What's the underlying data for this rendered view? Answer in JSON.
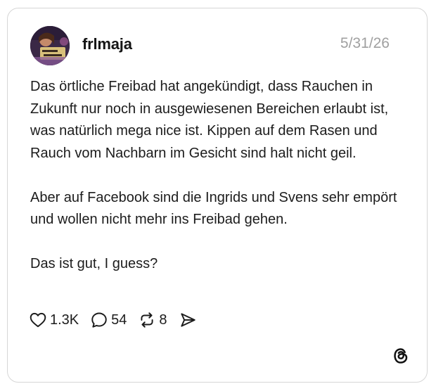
{
  "post": {
    "username": "frlmaja",
    "date": "5/31/26",
    "avatar_alt": "profile photo",
    "paragraphs": [
      "Das örtliche Freibad hat angekündigt, dass Rauchen in Zukunft nur noch in ausgewiesenen Bereichen erlaubt ist, was natürlich mega nice ist. Kippen auf dem Rasen und Rauch vom Nachbarn im Gesicht sind halt nicht geil.",
      "Aber auf Facebook sind die Ingrids und Svens sehr empört und wollen nicht mehr ins Freibad gehen.",
      "Das ist gut, I guess?"
    ]
  },
  "actions": {
    "likes": "1.3K",
    "replies": "54",
    "reposts": "8"
  },
  "icons": {
    "like": "heart-icon",
    "reply": "speech-bubble-icon",
    "repost": "repost-arrows-icon",
    "share": "send-icon",
    "brand": "threads-logo-icon"
  },
  "colors": {
    "text": "#1c1c1c",
    "muted": "#a0a0a0",
    "border": "#d6d6d6"
  }
}
